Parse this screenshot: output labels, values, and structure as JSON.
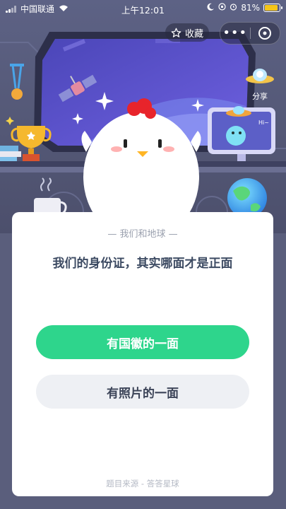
{
  "status_bar": {
    "carrier": "中国联通",
    "time": "上午12:01",
    "battery": "81%",
    "battery_level": 0.81
  },
  "header": {
    "favorite_label": "收藏",
    "share_label": "分享",
    "more_icon": "more-icon",
    "close_icon": "close-circle-icon"
  },
  "question_card": {
    "category": "— 我们和地球 —",
    "question": "我们的身份证，其实哪面才是正面",
    "options": [
      {
        "label": "有国徽的一面"
      },
      {
        "label": "有照片的一面"
      }
    ],
    "source": "题目来源 - 答答星球"
  },
  "decor": {
    "monitor_text": "Hi~"
  },
  "colors": {
    "primary_green": "#2ed58c",
    "option_gray": "#eef0f4",
    "question_text": "#3c4a62",
    "scene_bg": "#5d6285"
  }
}
